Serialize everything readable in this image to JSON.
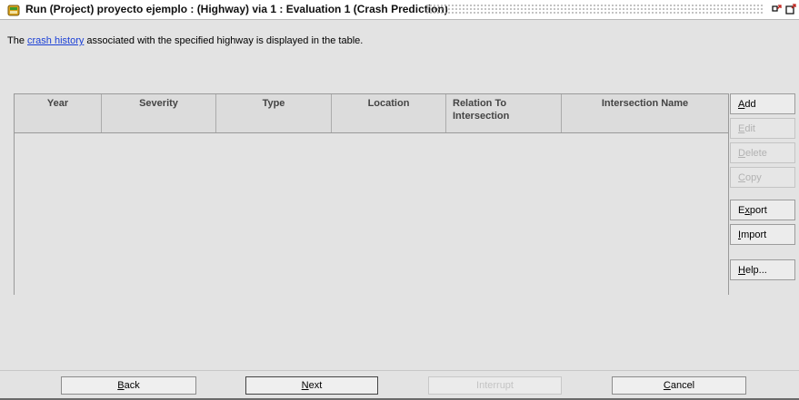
{
  "window": {
    "title": "Run (Project) proyecto ejemplo : (Highway) via 1 : Evaluation 1 (Crash Prediction)",
    "icons": [
      "app-icon",
      "restore-icon",
      "maximize-icon"
    ]
  },
  "intro": {
    "prefix": "The ",
    "link": "crash history",
    "suffix": " associated with the specified highway is displayed in the table."
  },
  "table": {
    "columns": [
      "Year",
      "Severity",
      "Type",
      "Location",
      "Relation To Intersection",
      "Intersection Name"
    ],
    "rows": []
  },
  "side_buttons": {
    "add": {
      "mnemonic": "A",
      "rest": "dd",
      "enabled": true
    },
    "edit": {
      "mnemonic": "E",
      "rest": "dit",
      "enabled": false
    },
    "delete": {
      "mnemonic": "D",
      "rest": "elete",
      "enabled": false
    },
    "copy": {
      "mnemonic": "C",
      "rest": "opy",
      "enabled": false
    },
    "export": {
      "before": "E",
      "mnemonic": "x",
      "rest": "port",
      "enabled": true
    },
    "import": {
      "mnemonic": "I",
      "rest": "mport",
      "enabled": true
    },
    "help": {
      "mnemonic": "H",
      "rest": "elp...",
      "enabled": true
    }
  },
  "footer_buttons": {
    "back": {
      "mnemonic": "B",
      "rest": "ack",
      "enabled": true
    },
    "next": {
      "mnemonic": "N",
      "rest": "ext",
      "enabled": true
    },
    "interrupt": {
      "label": "Interrupt",
      "enabled": false
    },
    "cancel": {
      "mnemonic": "C",
      "rest": "ancel",
      "enabled": true
    }
  }
}
